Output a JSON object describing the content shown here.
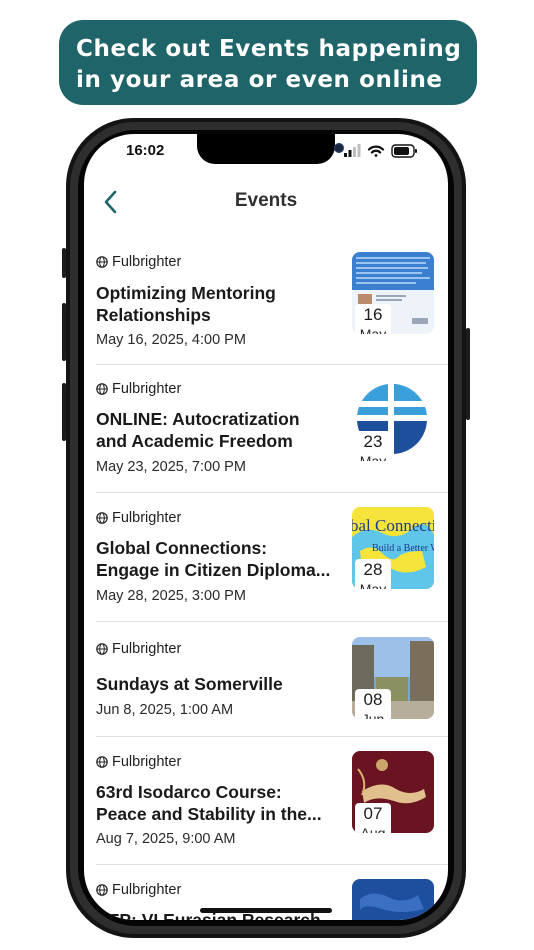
{
  "banner": {
    "line1": "Check out Events happening",
    "line2": "in your area or even online"
  },
  "status_bar": {
    "time": "16:02"
  },
  "nav": {
    "title": "Events"
  },
  "events": [
    {
      "organizer": "Fulbrighter",
      "title_lines": [
        "Optimizing Mentoring",
        "Relationships"
      ],
      "datetime": "May 16, 2025, 4:00 PM",
      "day": "16",
      "month": "May"
    },
    {
      "organizer": "Fulbrighter",
      "title_lines": [
        "ONLINE: Autocratization",
        "and Academic Freedom"
      ],
      "datetime": "May 23, 2025, 7:00 PM",
      "day": "23",
      "month": "May"
    },
    {
      "organizer": "Fulbrighter",
      "title_lines": [
        "Global Connections:",
        "Engage in Citizen Diploma..."
      ],
      "datetime": "May 28, 2025, 3:00 PM",
      "day": "28",
      "month": "May",
      "thumb_text": "bal Connecti",
      "thumb_subtext": "Build a Better World"
    },
    {
      "organizer": "Fulbrighter",
      "title_lines": [
        "Sundays at Somerville"
      ],
      "datetime": "Jun 8, 2025, 1:00 AM",
      "day": "08",
      "month": "Jun"
    },
    {
      "organizer": "Fulbrighter",
      "title_lines": [
        "63rd Isodarco Course:",
        "Peace and Stability in the..."
      ],
      "datetime": "Aug 7, 2025, 9:00 AM",
      "day": "07",
      "month": "Aug"
    },
    {
      "organizer": "Fulbrighter",
      "title_lines": [
        "CFP: VI Eurasian Research"
      ]
    }
  ]
}
